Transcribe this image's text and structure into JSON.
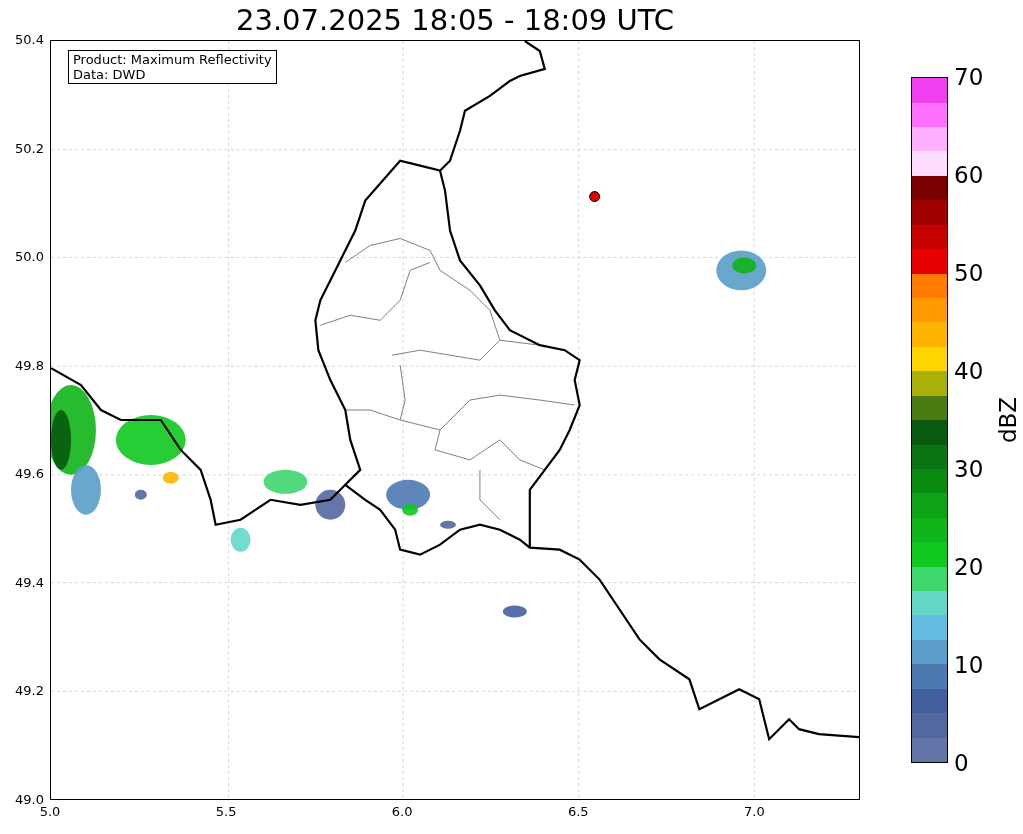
{
  "title": "23.07.2025 18:05 - 18:09 UTC",
  "info_box": [
    "Product: Maximum Reflectivity",
    "Data: DWD"
  ],
  "map": {
    "y_ticks": [
      "50.4",
      "50.2",
      "50.0",
      "49.8",
      "49.6",
      "49.4",
      "49.2",
      "49.0"
    ],
    "x_ticks": [
      "5.0",
      "5.5",
      "6.0",
      "6.5",
      "7.0"
    ]
  },
  "colorbar": {
    "label": "dBZ",
    "ticks": [
      "70",
      "60",
      "50",
      "40",
      "30",
      "20",
      "10",
      "0"
    ],
    "bands": [
      {
        "color": "#6374a6"
      },
      {
        "color": "#5468a0"
      },
      {
        "color": "#445f9e"
      },
      {
        "color": "#4d79b0"
      },
      {
        "color": "#5a9dc8"
      },
      {
        "color": "#62bde0"
      },
      {
        "color": "#63d8c8"
      },
      {
        "color": "#3ed66f"
      },
      {
        "color": "#10c81e"
      },
      {
        "color": "#10b51a"
      },
      {
        "color": "#0ea314"
      },
      {
        "color": "#0b8a10"
      },
      {
        "color": "#0a7412"
      },
      {
        "color": "#075a0e"
      },
      {
        "color": "#4a7a10"
      },
      {
        "color": "#aab00a"
      },
      {
        "color": "#ffd600"
      },
      {
        "color": "#ffb400"
      },
      {
        "color": "#ff9a00"
      },
      {
        "color": "#ff7c00"
      },
      {
        "color": "#e60000"
      },
      {
        "color": "#c80000"
      },
      {
        "color": "#a00000"
      },
      {
        "color": "#7a0000"
      },
      {
        "color": "#ffddff"
      },
      {
        "color": "#ffb0ff"
      },
      {
        "color": "#ff70ff"
      },
      {
        "color": "#f040f0"
      }
    ]
  }
}
